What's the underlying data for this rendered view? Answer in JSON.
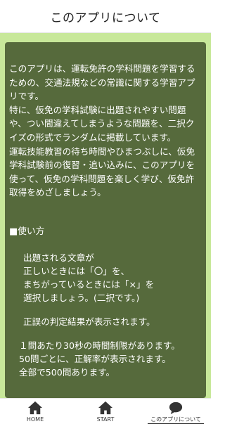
{
  "header": {
    "title": "このアプリについて"
  },
  "content": {
    "intro": [
      "このアプリは、運転免許の学科問題を学習するための、交通法規などの常識に関する学習アプリです。",
      "特に、仮免の学科試験に出題されやすい問題や、つい間違えてしまうような問題を、二択クイズの形式でランダムに掲載しています。",
      "運転技能教習の待ち時間やひまつぶしに、仮免学科試験前の復習・追い込みに、このアプリを使って、仮免の学科問題を楽しく学び、仮免許取得をめざしましょう。"
    ],
    "usage_title": "■使い方",
    "usage_lines": [
      "出題される文章が",
      "正しいときには「〇」を、",
      "まちがっているときには「×」を",
      "選択しましょう。(二択です。)"
    ],
    "judge_text": "正誤の判定結果が表示されます。",
    "rules_lines": [
      "１問あたり30秒の時間制限があります。",
      "50問ごとに、正解率が表示されます。",
      "全部で500問あります。"
    ]
  },
  "tabs": [
    {
      "label": "HOME",
      "icon": "house-icon"
    },
    {
      "label": "START",
      "icon": "house-icon"
    },
    {
      "label": "このアプリについて",
      "icon": "speech-bubble-icon"
    }
  ],
  "colors": {
    "accent": "#c8e89a",
    "panel": "#566a3c",
    "icon": "#333333"
  }
}
